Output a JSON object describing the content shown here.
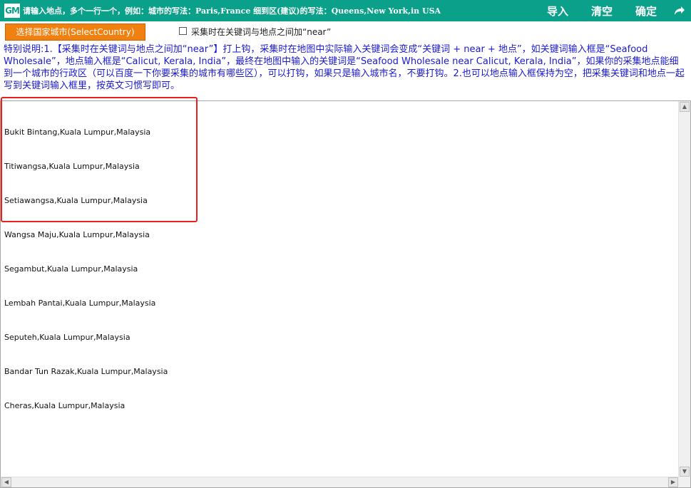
{
  "titlebar": {
    "logo": "GM",
    "instruction": "请输入地点，多个一行一个，例如：城市的写法：Paris,France 细到区(建议)的写法：Queens,New York,in USA",
    "import_label": "导入",
    "clear_label": "清空",
    "confirm_label": "确定",
    "share_icon": "share-arrow-icon"
  },
  "controls": {
    "select_country_label": "选择国家城市(SelectCountry)",
    "near_option_label": "采集时在关键词与地点之间加“near”",
    "near_checked": false
  },
  "note": "特别说明:1.【采集时在关键词与地点之间加“near”】打上钩，采集时在地图中实际输入关键词会变成“关键词 + near + 地点”，如关键词输入框是“Seafood Wholesale”，地点输入框是“Calicut, Kerala, India”，最终在地图中输入的关键词是“Seafood Wholesale near Calicut, Kerala, India”，如果你的采集地点能细到一个城市的行政区（可以百度一下你要采集的城市有哪些区），可以打钩，如果只是输入城市名，不要打钩。2.也可以地点输入框保持为空，把采集关键词和地点一起写到关键词输入框里，按英文习惯写即可。",
  "locations": [
    "Bukit Bintang,Kuala Lumpur,Malaysia",
    "Titiwangsa,Kuala Lumpur,Malaysia",
    "Setiawangsa,Kuala Lumpur,Malaysia",
    "Wangsa Maju,Kuala Lumpur,Malaysia",
    "Segambut,Kuala Lumpur,Malaysia",
    "Lembah Pantai,Kuala Lumpur,Malaysia",
    "Seputeh,Kuala Lumpur,Malaysia",
    "Bandar Tun Razak,Kuala Lumpur,Malaysia",
    "Cheras,Kuala Lumpur,Malaysia"
  ],
  "colors": {
    "titlebar": "#0ba08a",
    "select_button": "#f08010",
    "note_text": "#1a1ad0",
    "highlight_border": "#e8221b"
  }
}
